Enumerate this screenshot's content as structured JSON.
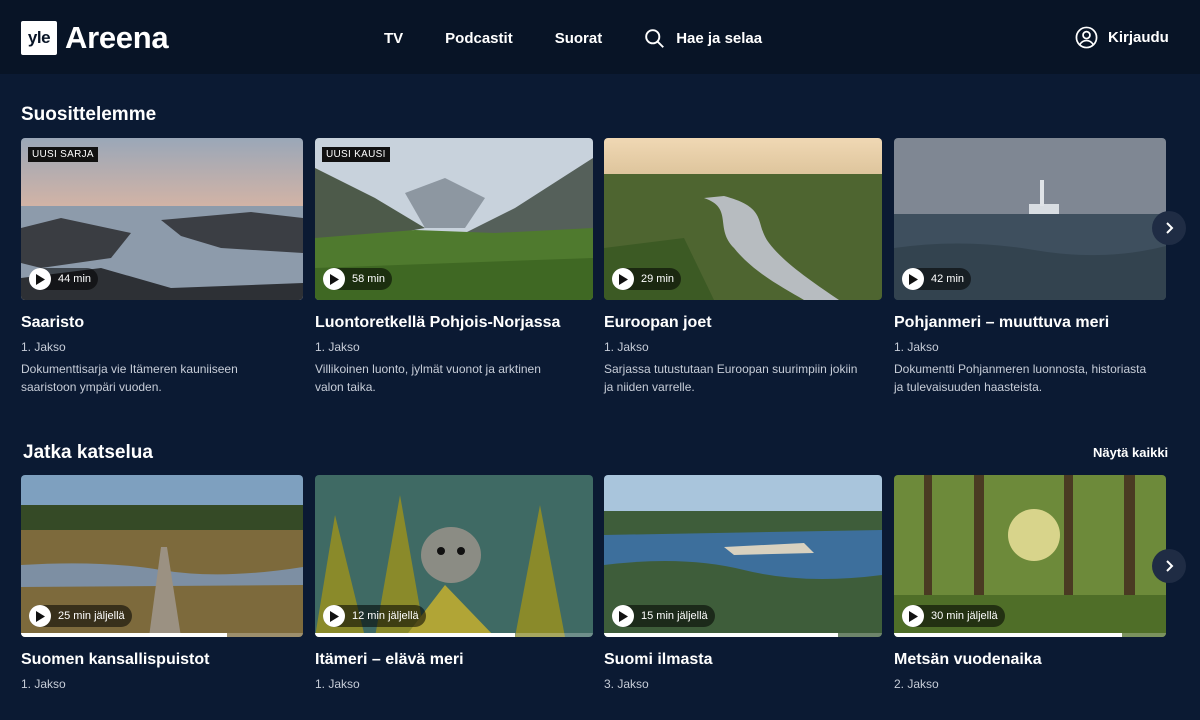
{
  "header": {
    "logo_mark": "yle",
    "logo_text": "Areena",
    "nav": [
      "TV",
      "Podcastit",
      "Suorat"
    ],
    "search_label": "Hae ja selaa",
    "login_label": "Kirjaudu"
  },
  "recommended": {
    "title": "Suosittelemme",
    "cards": [
      {
        "badge": "UUSI SARJA",
        "duration": "44 min",
        "title": "Saaristo",
        "episode": "1. Jakso",
        "desc1": "Dokumenttisarja vie Itämeren kauniiseen",
        "desc2": "saaristoon ympäri vuoden."
      },
      {
        "badge": "UUSI KAUSI",
        "duration": "58 min",
        "title": "Luontoretkellä Pohjois-Norjassa",
        "episode": "1. Jakso",
        "desc1": "Villikoinen luonto, jylmät vuonot ja arktinen",
        "desc2": "valon taika."
      },
      {
        "badge": "",
        "duration": "29 min",
        "title": "Euroopan joet",
        "episode": "1. Jakso",
        "desc1": "Sarjassa tutustutaan Euroopan suurimpiin jokiin",
        "desc2": "ja niiden varrelle."
      },
      {
        "badge": "",
        "duration": "42 min",
        "title": "Pohjanmeri – muuttuva meri",
        "episode": "1. Jakso",
        "desc1": "Dokumentti Pohjanmeren luonnosta, historiasta",
        "desc2": "ja tulevaisuuden haasteista."
      }
    ]
  },
  "continue": {
    "title": "Jatka katselua",
    "see_all": "Näytä kaikki",
    "cards": [
      {
        "duration": "25 min jäljellä",
        "title": "Suomen kansallispuistot",
        "episode": "1. Jakso",
        "progress": 0.73
      },
      {
        "duration": "12 min jäljellä",
        "title": "Itämeri – elävä meri",
        "episode": "1. Jakso",
        "progress": 0.72
      },
      {
        "duration": "15 min jäljellä",
        "title": "Suomi ilmasta",
        "episode": "3. Jakso",
        "progress": 0.84
      },
      {
        "duration": "30 min jäljellä",
        "title": "Metsän vuodenaika",
        "episode": "2. Jakso",
        "progress": 0.84
      }
    ]
  },
  "colors": {
    "background": "#0b1a33",
    "header": "#081426",
    "accent": "#ffffff"
  },
  "icons": {
    "search": "search-icon",
    "user": "user-icon",
    "play": "play-icon",
    "next": "chevron-right-icon"
  }
}
